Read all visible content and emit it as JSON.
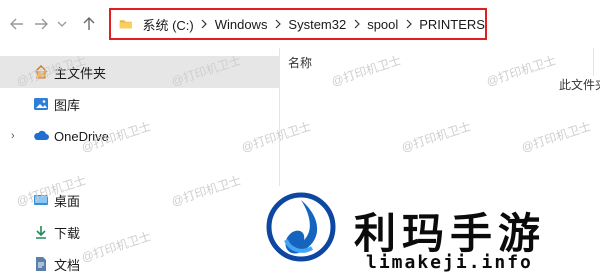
{
  "nav": {
    "back_icon": "arrow-left-icon",
    "forward_icon": "arrow-right-icon",
    "recent_icon": "chevron-down-icon",
    "up_icon": "arrow-up-icon"
  },
  "address_bar": {
    "folder_icon": "folder-icon",
    "breadcrumbs": [
      "系统 (C:)",
      "Windows",
      "System32",
      "spool",
      "PRINTERS"
    ],
    "highlight_color": "#e02020"
  },
  "sidebar": {
    "items": [
      {
        "label": "主文件夹",
        "icon": "home-icon",
        "selected": true
      },
      {
        "label": "图库",
        "icon": "gallery-icon"
      },
      {
        "label": "OneDrive",
        "icon": "cloud-icon",
        "expandable": true
      },
      {
        "label": "桌面",
        "icon": "desktop-icon"
      },
      {
        "label": "下载",
        "icon": "download-icon"
      },
      {
        "label": "文档",
        "icon": "document-icon"
      }
    ]
  },
  "content": {
    "column_header": "名称",
    "empty_message": "此文件夹"
  },
  "watermark": {
    "text": "@打印机卫士"
  },
  "brand": {
    "title": "利玛手游",
    "subtitle": "limakeji.info",
    "accent_color": "#1565c0"
  }
}
